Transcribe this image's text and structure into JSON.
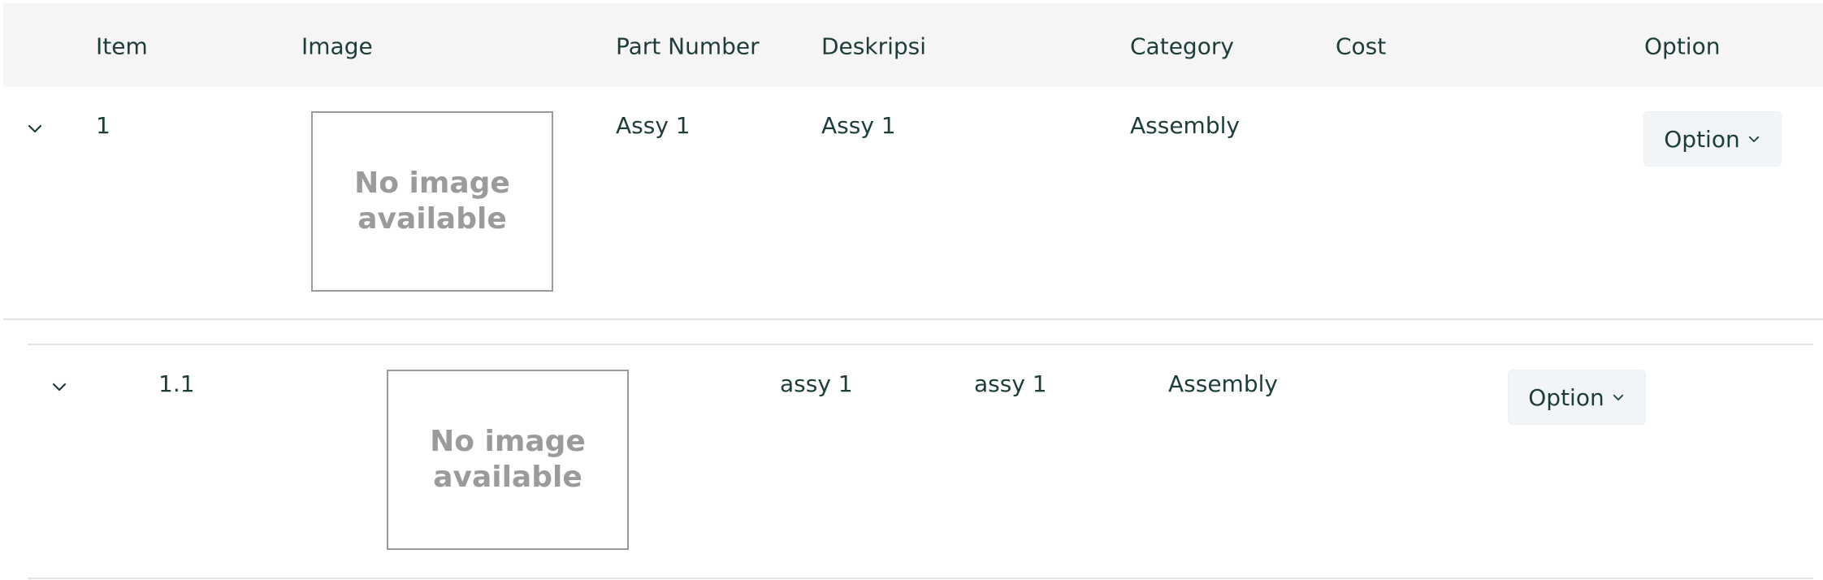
{
  "table": {
    "columns": {
      "item": "Item",
      "image": "Image",
      "part_number": "Part Number",
      "description": "Deskripsi",
      "category": "Category",
      "cost": "Cost",
      "option": "Option"
    },
    "rows": [
      {
        "item": "1",
        "image_placeholder": "No image\navailable",
        "part_number": "Assy 1",
        "description": "Assy 1",
        "category": "Assembly",
        "cost": "",
        "option_label": "Option",
        "expand_icon": "chevron-down-icon"
      },
      {
        "item": "1.1",
        "image_placeholder": "No image\navailable",
        "part_number": "assy 1",
        "description": "assy 1",
        "category": "Assembly",
        "cost": "",
        "option_label": "Option",
        "expand_icon": "chevron-down-icon"
      }
    ]
  },
  "colors": {
    "text": "#1c3d3a",
    "header_bg": "#f5f5f5",
    "button_bg": "#f2f5f8",
    "placeholder_text": "#9b9b9b",
    "border": "#e3e3e3"
  }
}
